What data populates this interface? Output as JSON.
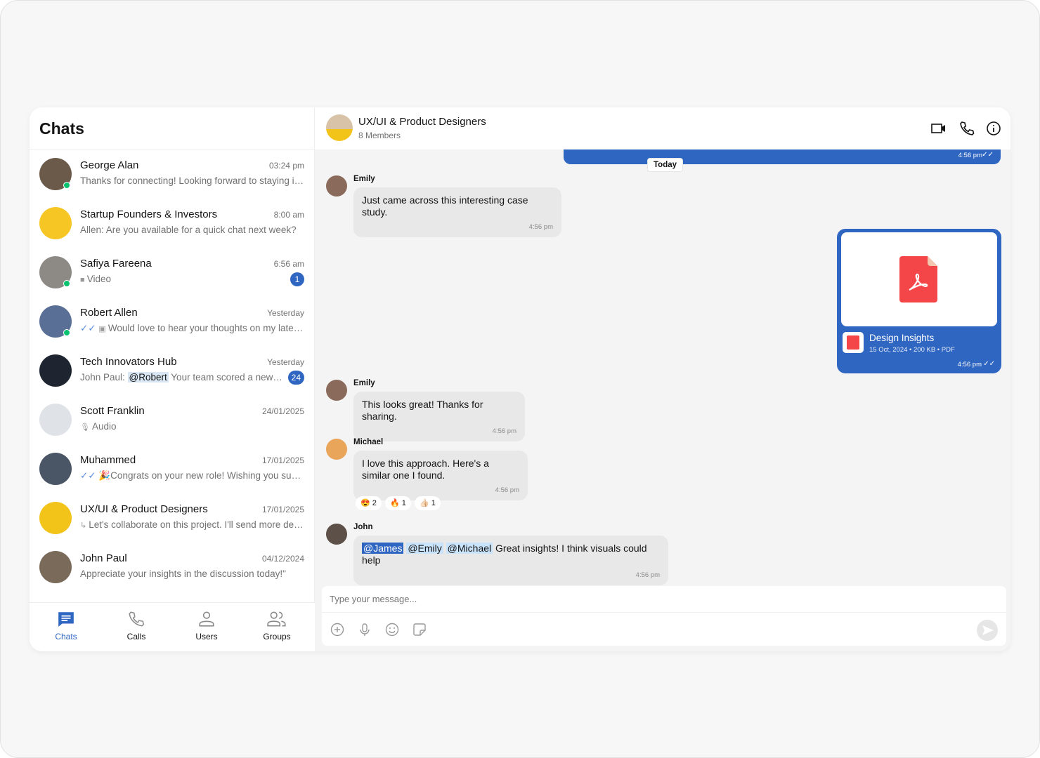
{
  "sidebar": {
    "title": "Chats",
    "chats": [
      {
        "name": "George Alan",
        "time": "03:24 pm",
        "preview": "Thanks for connecting! Looking forward to staying in touch.",
        "online": true,
        "avatar": "#6b5a4a"
      },
      {
        "name": "Startup Founders & Investors",
        "time": "8:00 am",
        "prefix": "Allen: ",
        "preview": "Are you available for a quick chat next week?",
        "avatar": "#f6c624"
      },
      {
        "name": "Safiya Fareena",
        "time": "6:56 am",
        "preview": "Video",
        "icon": "video-icon",
        "badge": "1",
        "online": true,
        "avatar": "#8d8a86"
      },
      {
        "name": "Robert Allen",
        "time": "Yesterday",
        "preview": "Would love to hear your thoughts on my latest post",
        "icon": "image-icon",
        "read": true,
        "online": true,
        "avatar": "#5a6f96"
      },
      {
        "name": "Tech Innovators Hub",
        "time": "Yesterday",
        "prefix": "John Paul: ",
        "mention": "@Robert",
        "preview": "Your team scored a new milestone!",
        "badge": "24",
        "avatar": "#1e2530"
      },
      {
        "name": "Scott Franklin",
        "time": "24/01/2025",
        "preview": "Audio",
        "icon": "mic-icon",
        "avatar": "#dfe3e8"
      },
      {
        "name": "Muhammed",
        "time": "17/01/2025",
        "preview": "🎉Congrats on your new role! Wishing you success!",
        "read": true,
        "avatar": "#4a5666"
      },
      {
        "name": "UX/UI & Product Designers",
        "time": "17/01/2025",
        "preview": "Let's collaborate on this project. I'll send more details soon.",
        "icon": "reply-icon",
        "avatar": "#f2c319"
      },
      {
        "name": "John Paul",
        "time": "04/12/2024",
        "preview": "Appreciate your insights in the discussion today!\"",
        "avatar": "#7a6a5a"
      }
    ],
    "nav": [
      {
        "label": "Chats",
        "active": true
      },
      {
        "label": "Calls"
      },
      {
        "label": "Users"
      },
      {
        "label": "Groups"
      }
    ]
  },
  "header": {
    "title": "UX/UI & Product Designers",
    "subtitle": "8 Members"
  },
  "messages": {
    "prev_time": "4:56 pm",
    "date_sep": "Today",
    "m1": {
      "sender": "Emily",
      "text": "Just came across this interesting case study.",
      "time": "4:56 pm"
    },
    "file": {
      "name": "Design Insights",
      "meta": "15 Oct, 2024 • 200 KB • PDF",
      "time": "4:56 pm"
    },
    "m2": {
      "sender": "Emily",
      "text": "This looks great! Thanks for sharing.",
      "time": "4:56 pm"
    },
    "m3": {
      "sender": "Michael",
      "text": "I love this approach. Here's a similar one I found.",
      "time": "4:56 pm",
      "reactions": [
        {
          "emoji": "😍",
          "count": "2"
        },
        {
          "emoji": "🔥",
          "count": "1"
        },
        {
          "emoji": "👍🏻",
          "count": "1"
        }
      ]
    },
    "m4": {
      "sender": "John",
      "mentions": [
        "@James",
        "@Emily",
        "@Michael"
      ],
      "text": "Great insights! I think visuals could help",
      "time": "4:56 pm"
    }
  },
  "composer": {
    "placeholder": "Type your message..."
  },
  "colors": {
    "accent": "#2f66c1",
    "online": "#09c26f",
    "pdf": "#f44649"
  }
}
